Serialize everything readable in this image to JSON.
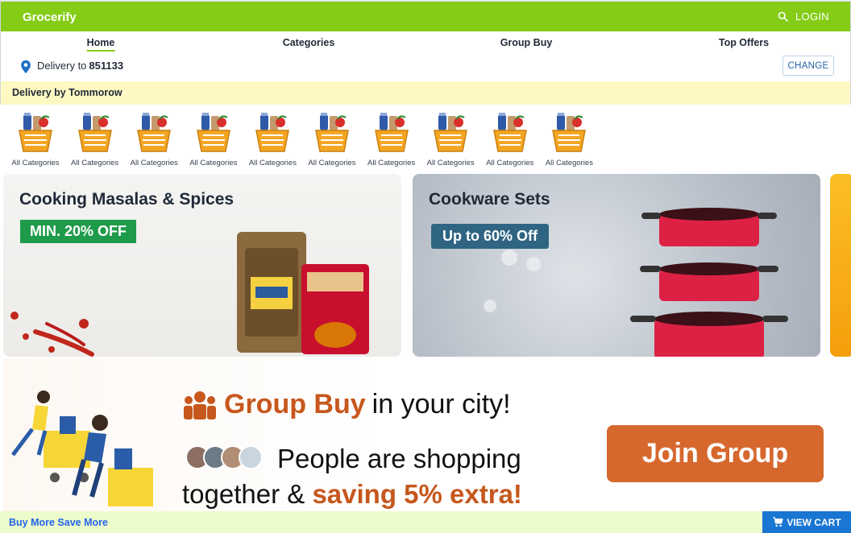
{
  "app": {
    "brand": "Grocerify",
    "login_label": "LOGIN"
  },
  "nav": {
    "items": [
      {
        "label": "Home",
        "active": true
      },
      {
        "label": "Categories"
      },
      {
        "label": "Group Buy"
      },
      {
        "label": "Top Offers"
      }
    ]
  },
  "delivery": {
    "label": "Delivery to",
    "pincode": "851133",
    "change_label": "CHANGE"
  },
  "notice": {
    "text": "Delivery by Tommorow"
  },
  "categories": [
    {
      "label": "All Categories"
    },
    {
      "label": "All Categories"
    },
    {
      "label": "All Categories"
    },
    {
      "label": "All Categories"
    },
    {
      "label": "All Categories"
    },
    {
      "label": "All Categories"
    },
    {
      "label": "All Categories"
    },
    {
      "label": "All Categories"
    },
    {
      "label": "All Categories"
    },
    {
      "label": "All Categories"
    }
  ],
  "promos": [
    {
      "title": "Cooking Masalas & Spices",
      "badge": "MIN. 20% OFF"
    },
    {
      "title": "Cookware Sets",
      "badge": "Up to 60% Off"
    }
  ],
  "group_buy": {
    "title_accent": "Group Buy",
    "title_rest": "in your city!",
    "line1": "People are shopping",
    "line2_prefix": "together &",
    "line2_accent": "saving 5% extra!",
    "cta": "Join Group"
  },
  "footer": {
    "text": "Buy More Save More",
    "cart_label": "VIEW CART"
  },
  "colors": {
    "brand_green": "#84cc16",
    "accent_orange": "#c6571d",
    "cart_blue": "#1976d2"
  }
}
